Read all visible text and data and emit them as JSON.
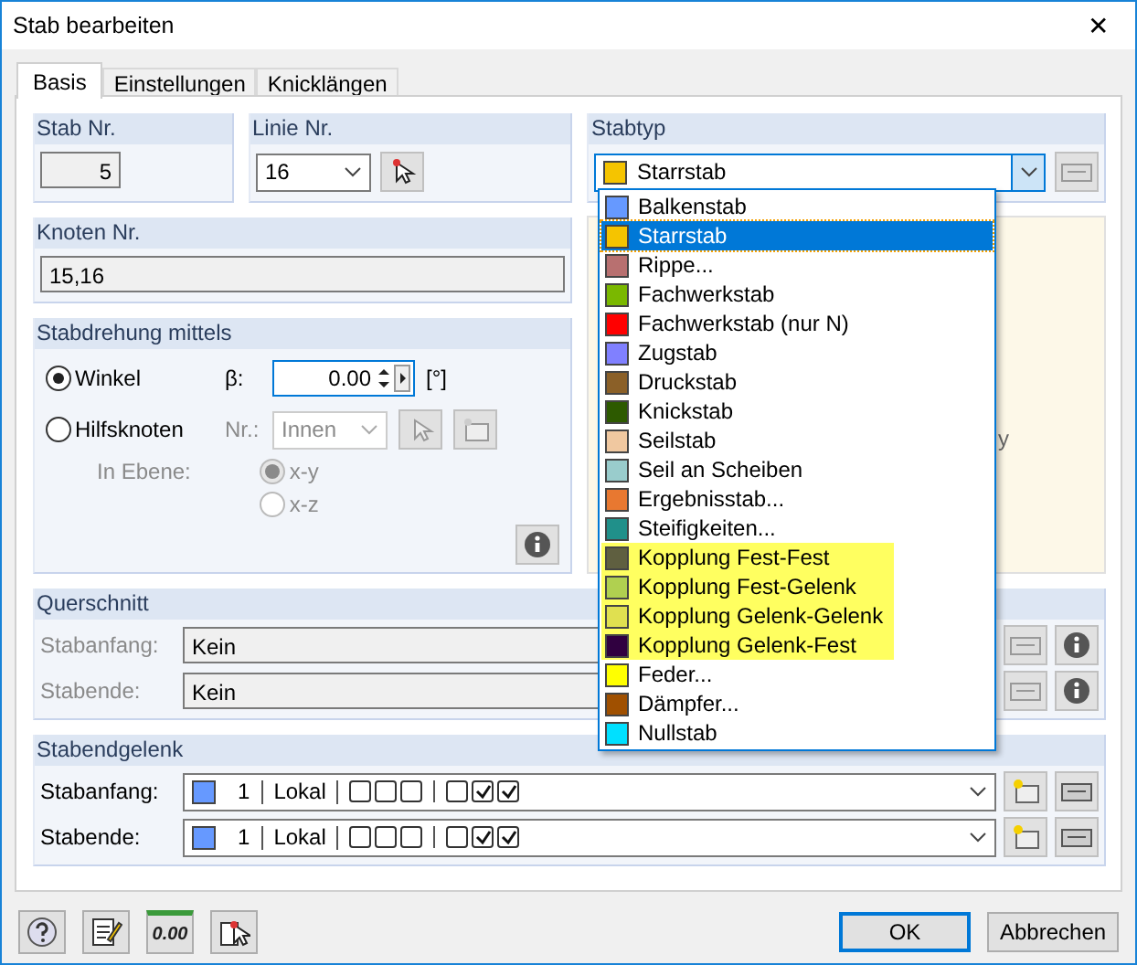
{
  "window": {
    "title": "Stab bearbeiten",
    "close": "✕"
  },
  "tabs": [
    {
      "label": "Basis",
      "selected": true
    },
    {
      "label": "Einstellungen",
      "selected": false
    },
    {
      "label": "Knicklängen",
      "selected": false
    }
  ],
  "stab_nr": {
    "label": "Stab Nr.",
    "value": "5"
  },
  "linie_nr": {
    "label": "Linie Nr.",
    "value": "16"
  },
  "knoten_nr": {
    "label": "Knoten Nr.",
    "value": "15,16"
  },
  "stabdrehung": {
    "title": "Stabdrehung mittels",
    "modes": [
      {
        "label": "Winkel",
        "selected": true
      },
      {
        "label": "Hilfsknoten",
        "selected": false
      }
    ],
    "beta_label": "β:",
    "beta_value": "0.00",
    "unit": "[°]",
    "nr_label": "Nr.:",
    "nr_value": "Innen",
    "ebene_label": "In Ebene:",
    "ebene": [
      {
        "label": "x-y",
        "selected": true
      },
      {
        "label": "x-z",
        "selected": false
      }
    ]
  },
  "stabtyp": {
    "label": "Stabtyp",
    "value": "Starrstab",
    "color": "#f5c400",
    "options": [
      {
        "label": "Balkenstab",
        "color": "#6699ff",
        "selected": false,
        "highlighted": false
      },
      {
        "label": "Starrstab",
        "color": "#f5c400",
        "selected": true,
        "highlighted": false
      },
      {
        "label": "Rippe...",
        "color": "#b87070",
        "selected": false,
        "highlighted": false
      },
      {
        "label": "Fachwerkstab",
        "color": "#7ab800",
        "selected": false,
        "highlighted": false
      },
      {
        "label": "Fachwerkstab (nur N)",
        "color": "#ff0000",
        "selected": false,
        "highlighted": false
      },
      {
        "label": "Zugstab",
        "color": "#8080ff",
        "selected": false,
        "highlighted": false
      },
      {
        "label": "Druckstab",
        "color": "#8b6028",
        "selected": false,
        "highlighted": false
      },
      {
        "label": "Knickstab",
        "color": "#2d5a00",
        "selected": false,
        "highlighted": false
      },
      {
        "label": "Seilstab",
        "color": "#f0c8a0",
        "selected": false,
        "highlighted": false
      },
      {
        "label": "Seil an Scheiben",
        "color": "#99cccc",
        "selected": false,
        "highlighted": false
      },
      {
        "label": "Ergebnisstab...",
        "color": "#e87830",
        "selected": false,
        "highlighted": false
      },
      {
        "label": "Steifigkeiten...",
        "color": "#20908a",
        "selected": false,
        "highlighted": false
      },
      {
        "label": "Kopplung Fest-Fest",
        "color": "#5f5f40",
        "selected": false,
        "highlighted": true
      },
      {
        "label": "Kopplung Fest-Gelenk",
        "color": "#b0d050",
        "selected": false,
        "highlighted": true
      },
      {
        "label": "Kopplung Gelenk-Gelenk",
        "color": "#e0e050",
        "selected": false,
        "highlighted": true
      },
      {
        "label": "Kopplung Gelenk-Fest",
        "color": "#300040",
        "selected": false,
        "highlighted": true
      },
      {
        "label": "Feder...",
        "color": "#ffff00",
        "selected": false,
        "highlighted": false
      },
      {
        "label": "Dämpfer...",
        "color": "#a05000",
        "selected": false,
        "highlighted": false
      },
      {
        "label": "Nullstab",
        "color": "#00e0ff",
        "selected": false,
        "highlighted": false
      }
    ]
  },
  "preview": {
    "axis_label": "y"
  },
  "querschnitt": {
    "title": "Querschnitt",
    "rows": [
      {
        "label": "Stabanfang:",
        "value": "Kein"
      },
      {
        "label": "Stabende:",
        "value": "Kein"
      }
    ]
  },
  "stabendgelenk": {
    "title": "Stabendgelenk",
    "rows": [
      {
        "label": "Stabanfang:",
        "color": "#6699ff",
        "number": "1",
        "system": "Lokal",
        "group1": [
          false,
          false,
          false
        ],
        "group2": [
          false,
          true,
          true
        ]
      },
      {
        "label": "Stabende:",
        "color": "#6699ff",
        "number": "1",
        "system": "Lokal",
        "group1": [
          false,
          false,
          false
        ],
        "group2": [
          false,
          true,
          true
        ]
      }
    ]
  },
  "footer": {
    "units_icon": "0.00",
    "ok": "OK",
    "cancel": "Abbrechen"
  }
}
